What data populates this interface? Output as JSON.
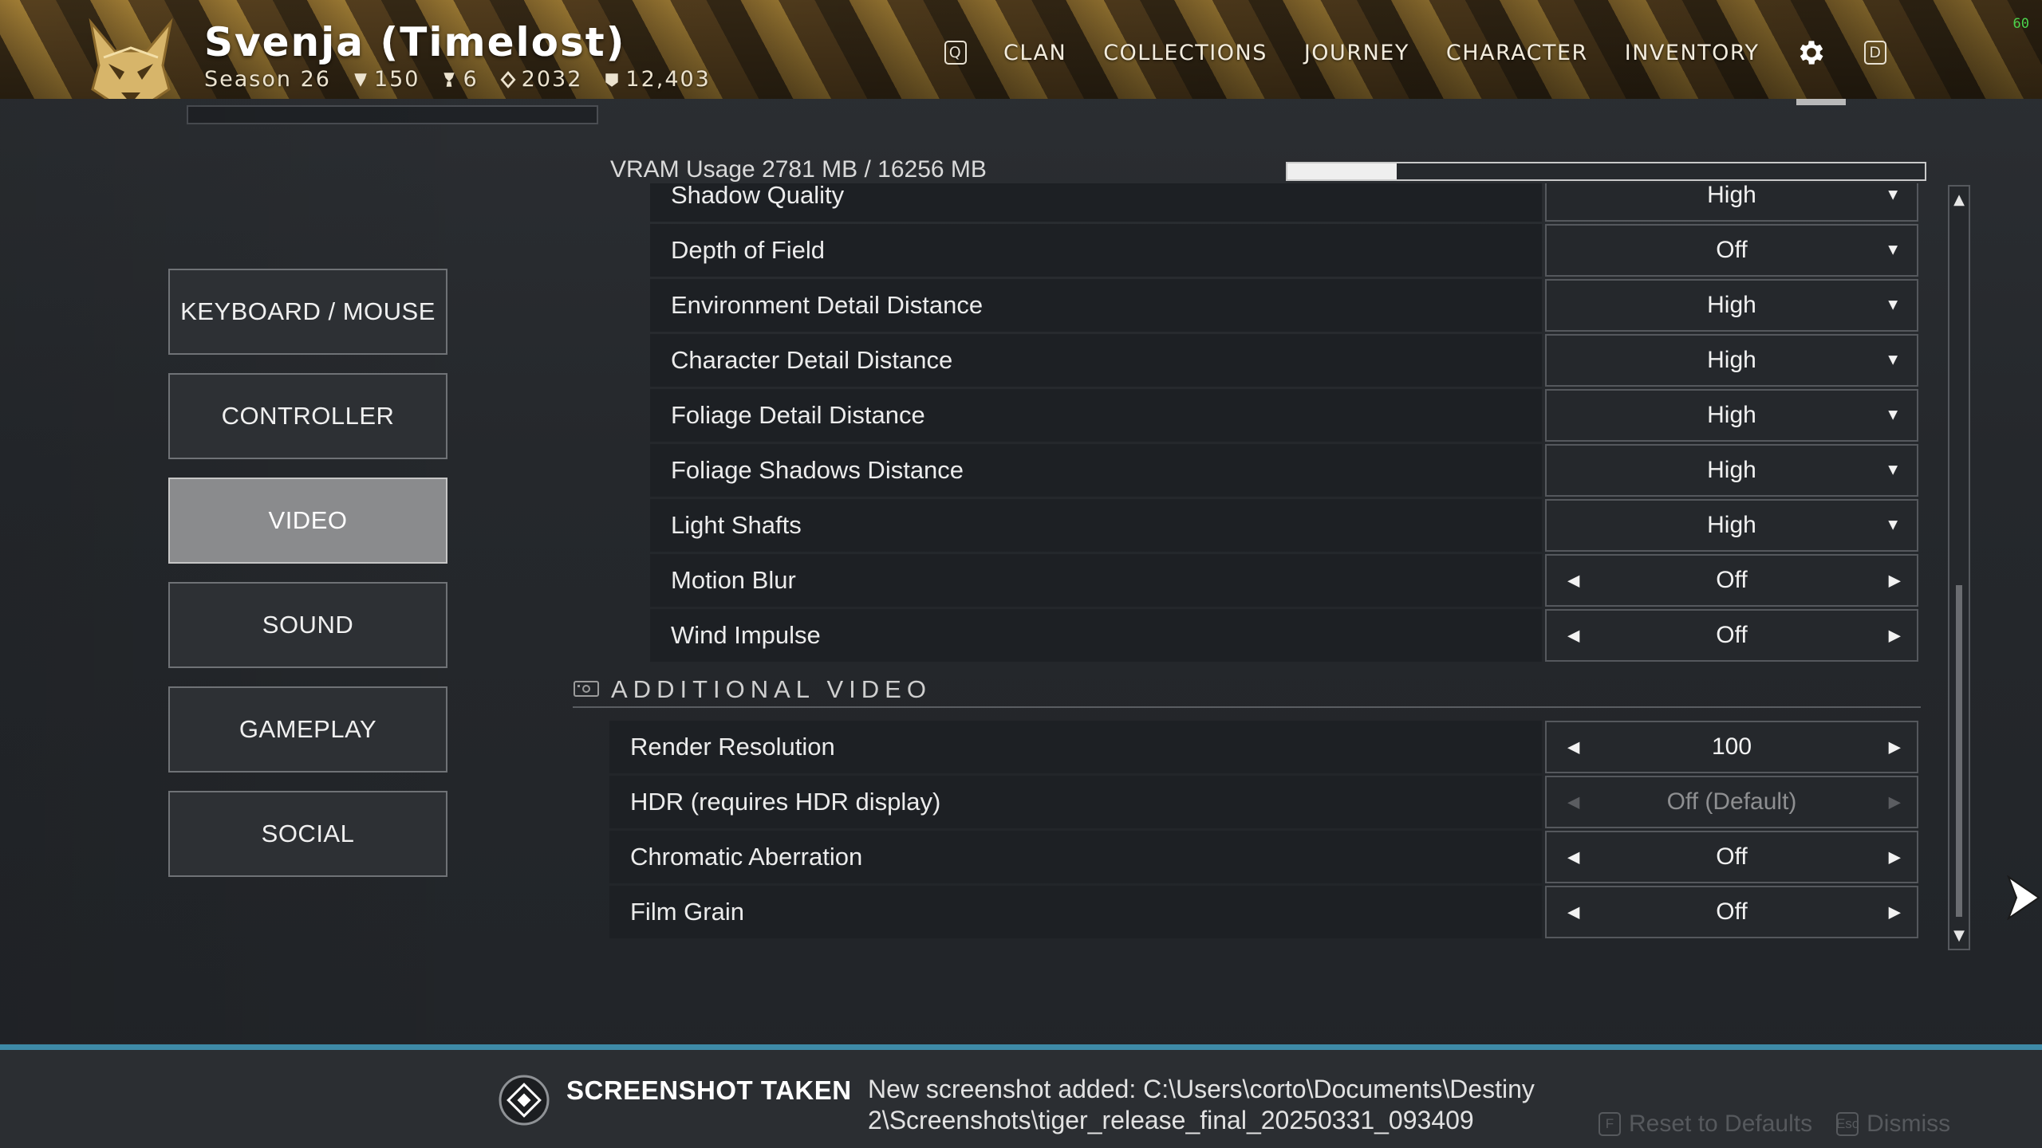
{
  "header": {
    "player_name": "Svenja (Timelost)",
    "season": "Season 26",
    "stats": [
      {
        "icon": "guardian-rank-icon",
        "value": "150"
      },
      {
        "icon": "triumph-icon",
        "value": "6"
      },
      {
        "icon": "power-level-icon",
        "value": "2032"
      },
      {
        "icon": "commendation-icon",
        "value": "12,403"
      }
    ],
    "nav_left_key": "Q",
    "nav_right_key": "D",
    "nav_items": [
      "CLAN",
      "COLLECTIONS",
      "JOURNEY",
      "CHARACTER",
      "INVENTORY"
    ],
    "fps": "60"
  },
  "menu": {
    "items": [
      "KEYBOARD / MOUSE",
      "CONTROLLER",
      "VIDEO",
      "SOUND",
      "GAMEPLAY",
      "SOCIAL"
    ],
    "active": "VIDEO"
  },
  "vram": {
    "label": "VRAM Usage 2781 MB / 16256 MB",
    "used_fraction": 0.171
  },
  "video_settings": [
    {
      "label": "Shadow Quality",
      "value": "High",
      "control": "dropdown"
    },
    {
      "label": "Depth of Field",
      "value": "Off",
      "control": "dropdown"
    },
    {
      "label": "Environment Detail Distance",
      "value": "High",
      "control": "dropdown"
    },
    {
      "label": "Character Detail Distance",
      "value": "High",
      "control": "dropdown"
    },
    {
      "label": "Foliage Detail Distance",
      "value": "High",
      "control": "dropdown"
    },
    {
      "label": "Foliage Shadows Distance",
      "value": "High",
      "control": "dropdown"
    },
    {
      "label": "Light Shafts",
      "value": "High",
      "control": "dropdown"
    },
    {
      "label": "Motion Blur",
      "value": "Off",
      "control": "stepper"
    },
    {
      "label": "Wind Impulse",
      "value": "Off",
      "control": "stepper"
    }
  ],
  "additional_video": {
    "title": "ADDITIONAL VIDEO",
    "settings": [
      {
        "label": "Render Resolution",
        "value": "100",
        "control": "stepper"
      },
      {
        "label": "HDR (requires HDR display)",
        "value": "Off (Default)",
        "control": "stepper",
        "disabled": true
      },
      {
        "label": "Chromatic Aberration",
        "value": "Off",
        "control": "stepper"
      },
      {
        "label": "Film Grain",
        "value": "Off",
        "control": "stepper"
      }
    ]
  },
  "notification": {
    "title": "SCREENSHOT TAKEN",
    "message": "New screenshot added: C:\\Users\\corto\\Documents\\Destiny 2\\Screenshots\\tiger_release_final_20250331_093409",
    "reset_key": "F",
    "reset_label": "Reset to Defaults",
    "dismiss_key": "Esc",
    "dismiss_label": "Dismiss"
  },
  "colors": {
    "accent": "#3e8aa7",
    "active_menu": "#8a8b8d",
    "fps_text": "#4cd24c"
  }
}
